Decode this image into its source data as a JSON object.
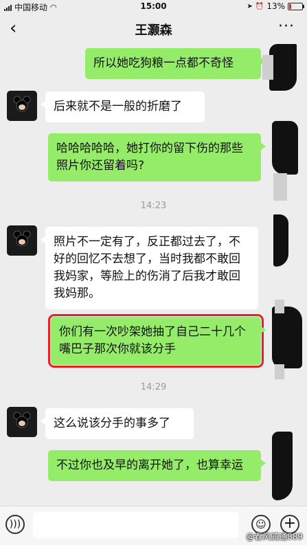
{
  "status_bar": {
    "carrier": "中国移动",
    "time": "15:00",
    "battery": "13%",
    "signal_icon": "signal-bars-icon",
    "wifi_icon": "wifi-icon"
  },
  "header": {
    "back_icon": "chevron-left-icon",
    "title": "王灏森",
    "more_icon": "ellipsis-icon"
  },
  "messages": [
    {
      "side": "right",
      "text": "所以她吃狗粮一点都不奇怪"
    },
    {
      "side": "left",
      "text": "后来就不是一般的折磨了"
    },
    {
      "side": "right",
      "text": "哈哈哈哈哈，她打你的留下伤的那些照片你还留着吗?"
    },
    {
      "side": "time",
      "text": "14:23"
    },
    {
      "side": "left",
      "text": "照片不一定有了，反正都过去了，不好的回忆不去想了，当时我都不敢回我妈家，等脸上的伤消了后我才敢回我妈那。"
    },
    {
      "side": "right",
      "text": "你们有一次吵架她抽了自己二十几个嘴巴子那次你就该分手",
      "highlighted": true
    },
    {
      "side": "time",
      "text": "14:29"
    },
    {
      "side": "left",
      "text": "这么说该分手的事多了"
    },
    {
      "side": "right",
      "text": "不过你也及早的离开她了，也算幸运"
    }
  ],
  "input_bar": {
    "voice_icon": "voice-icon",
    "emoji_icon": "emoji-icon",
    "plus_icon": "plus-icon"
  },
  "watermark": "@春风骑通889",
  "colors": {
    "background": "#ededed",
    "sent_bubble": "#95ec69",
    "received_bubble": "#ffffff",
    "highlight_border": "#e5202a"
  }
}
